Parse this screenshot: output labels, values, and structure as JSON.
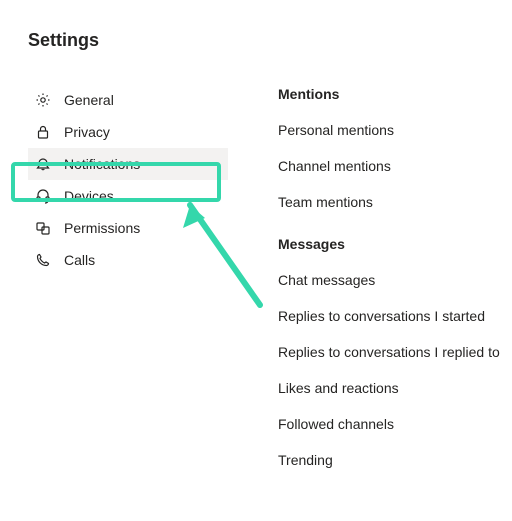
{
  "page_title": "Settings",
  "sidebar": {
    "items": [
      {
        "label": "General"
      },
      {
        "label": "Privacy"
      },
      {
        "label": "Notifications"
      },
      {
        "label": "Devices"
      },
      {
        "label": "Permissions"
      },
      {
        "label": "Calls"
      }
    ]
  },
  "main": {
    "sections": [
      {
        "heading": "Mentions",
        "items": [
          "Personal mentions",
          "Channel mentions",
          "Team mentions"
        ]
      },
      {
        "heading": "Messages",
        "items": [
          "Chat messages",
          "Replies to conversations I started",
          "Replies to conversations I replied to",
          "Likes and reactions",
          "Followed channels",
          "Trending"
        ]
      }
    ]
  },
  "annotation": {
    "highlight_color": "#34d7ab"
  }
}
